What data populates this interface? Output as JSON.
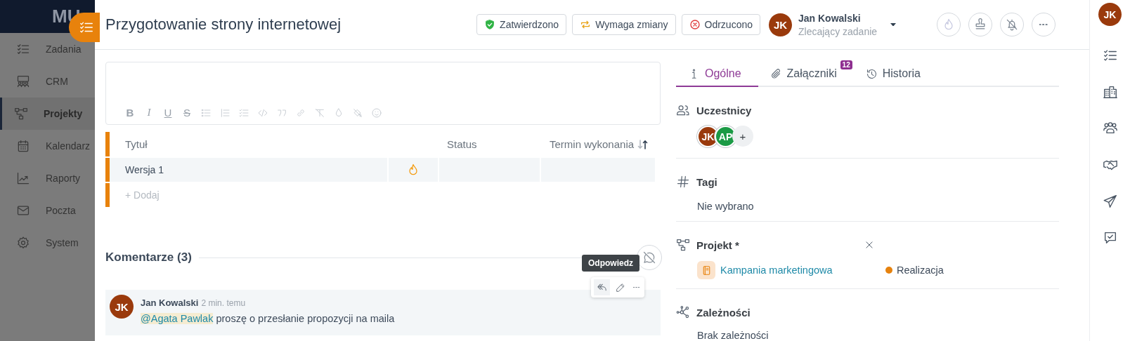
{
  "sidebar": {
    "logo": "MU",
    "items": [
      {
        "label": "Zadania",
        "selected": false
      },
      {
        "label": "CRM",
        "selected": false
      },
      {
        "label": "Projekty",
        "selected": true
      },
      {
        "label": "Kalendarz",
        "selected": false
      },
      {
        "label": "Raporty",
        "selected": false
      },
      {
        "label": "Poczta",
        "selected": false
      },
      {
        "label": "System",
        "selected": false
      }
    ]
  },
  "task": {
    "title": "Przygotowanie strony internetowej",
    "status_buttons": [
      {
        "label": "Zatwierdzono",
        "kind": "approved"
      },
      {
        "label": "Wymaga zmiany",
        "kind": "changes"
      },
      {
        "label": "Odrzucono",
        "kind": "rejected"
      }
    ],
    "assignee": {
      "initials": "JK",
      "name": "Jan Kowalski",
      "role": "Zlecający zadanie"
    }
  },
  "editor": {
    "format_buttons": [
      {
        "kind": "bold",
        "label": "B"
      },
      {
        "kind": "italic",
        "label": "I"
      },
      {
        "kind": "underline",
        "label": "U"
      },
      {
        "kind": "strike",
        "label": "S"
      }
    ]
  },
  "subtasks": {
    "columns": [
      "Tytuł",
      "Status",
      "Termin wykonania"
    ],
    "rows": [
      {
        "title": "Wersja 1",
        "hot": true
      }
    ],
    "add_label": "+ Dodaj"
  },
  "comments": {
    "heading": "Komentarze (3)",
    "tooltip": "Odpowiedz",
    "items": [
      {
        "initials": "JK",
        "author": "Jan Kowalski",
        "time": "2 min. temu",
        "mention": "@Agata Pawlak",
        "text": "proszę o przesłanie propozycji na maila"
      }
    ]
  },
  "tabs": [
    {
      "label": "Ogólne",
      "selected": true
    },
    {
      "label": "Załączniki",
      "selected": false,
      "badge": "12"
    },
    {
      "label": "Historia",
      "selected": false
    }
  ],
  "details": {
    "participants": {
      "heading": "Uczestnicy",
      "people": [
        {
          "initials": "JK",
          "color": "#9a3a0c"
        },
        {
          "initials": "AP",
          "color": "#1b9a45"
        }
      ],
      "add_label": "+"
    },
    "tags": {
      "heading": "Tagi",
      "value": "Nie wybrano"
    },
    "project": {
      "heading": "Projekt *",
      "name": "Kampania marketingowa",
      "status": {
        "label": "Realizacja",
        "color": "#e6820e"
      }
    },
    "dependencies": {
      "heading": "Zależności",
      "value": "Brak zależności"
    }
  },
  "rail": {
    "initials": "JK"
  }
}
